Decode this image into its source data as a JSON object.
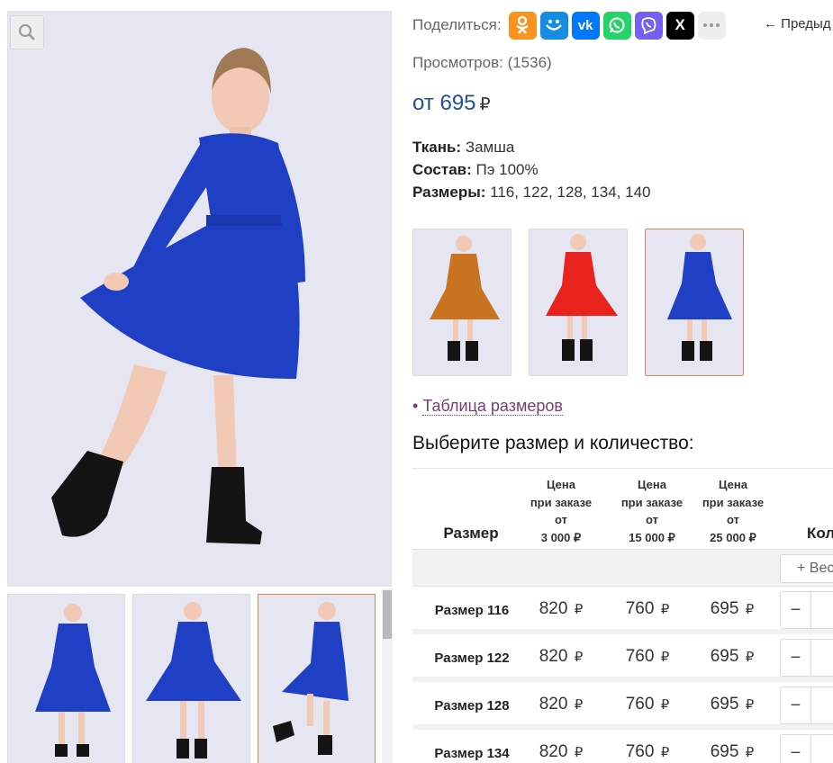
{
  "gallery": {
    "zoom_icon": "magnifier-icon"
  },
  "share": {
    "label": "Поделиться:",
    "buttons": [
      {
        "name": "ok",
        "color": "#f7931e",
        "icon": "odnoklassniki-icon"
      },
      {
        "name": "mail",
        "color": "#168de2",
        "icon": "moi-mir-icon"
      },
      {
        "name": "vk",
        "color": "#0077ff",
        "icon": "vk-icon",
        "text": "vk"
      },
      {
        "name": "whatsapp",
        "color": "#25d366",
        "icon": "whatsapp-icon"
      },
      {
        "name": "viber",
        "color": "#7360f2",
        "icon": "viber-icon"
      },
      {
        "name": "x",
        "color": "#000000",
        "icon": "x-icon",
        "text": "X"
      },
      {
        "name": "more",
        "color": "#eeeeee",
        "icon": "more-dots-icon"
      }
    ],
    "prev_label": "← Предыд"
  },
  "product": {
    "views": "Просмотров: (1536)",
    "price_prefix": "от 695",
    "currency": "₽",
    "props": [
      {
        "label": "Ткань:",
        "value": " Замша"
      },
      {
        "label": "Состав:",
        "value": " Пэ 100%"
      },
      {
        "label": "Размеры:",
        "value": " 116, 122, 128, 134, 140"
      }
    ],
    "colors": [
      {
        "dress": "#c8731f"
      },
      {
        "dress": "#e8231d"
      },
      {
        "dress": "#1f3fc4"
      }
    ],
    "size_table_link": "Таблица размеров",
    "bullet": "•",
    "choose_title": "Выберите размер и количество:"
  },
  "table": {
    "col_size": "Размер",
    "col_prices": [
      [
        "Цена",
        "при заказе",
        "от",
        "3 000 ₽"
      ],
      [
        "Цена",
        "при заказе",
        "от",
        "15 000 ₽"
      ],
      [
        "Цена",
        "при заказе",
        "от",
        "25 000 ₽"
      ]
    ],
    "col_qty": "Количество",
    "all_button": "+ Весь ряд",
    "rows": [
      {
        "size": "Размер 116",
        "p1": "820",
        "p2": "760",
        "p3": "695"
      },
      {
        "size": "Размер 122",
        "p1": "820",
        "p2": "760",
        "p3": "695"
      },
      {
        "size": "Размер 128",
        "p1": "820",
        "p2": "760",
        "p3": "695"
      },
      {
        "size": "Размер 134",
        "p1": "820",
        "p2": "760",
        "p3": "695"
      }
    ],
    "minus": "−",
    "rub": "₽"
  }
}
